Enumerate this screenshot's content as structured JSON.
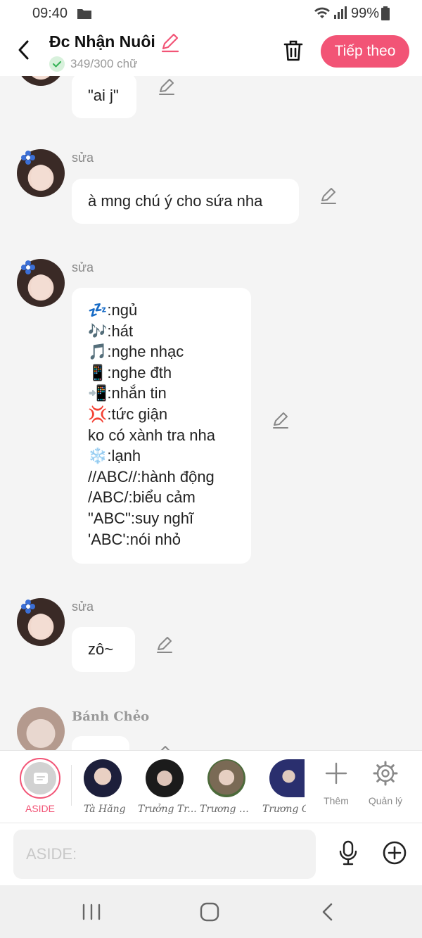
{
  "status_bar": {
    "time": "09:40",
    "battery": "99%"
  },
  "header": {
    "title": "Đc Nhận Nuôi",
    "word_count": "349/300 chữ",
    "next_label": "Tiếp theo"
  },
  "messages": [
    {
      "text": "\"ai j\""
    },
    {
      "sender": "sửa",
      "text": "à mng chú ý cho sứa nha"
    },
    {
      "sender": "sửa",
      "lines": [
        "💤:ngủ",
        "🎶:hát",
        "🎵:nghe nhạc",
        "📱:nghe đth",
        "📲:nhắn tin",
        "💢:tức giận",
        "ko có xành tra nha",
        "❄️:lạnh",
        "//ABC//:hành động",
        "/ABC/:biểu cảm",
        "\"ABC\":suy nghĩ",
        "'ABC':nói nhỏ"
      ]
    },
    {
      "sender": "sửa",
      "text": "zô~"
    },
    {
      "sender": "Bánh Chẻo"
    }
  ],
  "characters": {
    "aside_label": "ASIDE",
    "items": [
      {
        "name": "Tà Hăng"
      },
      {
        "name": "Trưởng Tr..."
      },
      {
        "name": "Trương T..."
      },
      {
        "name": "Trương C"
      }
    ],
    "more_label": "Thêm",
    "manage_label": "Quản lý"
  },
  "input": {
    "placeholder": "ASIDE:"
  },
  "colors": {
    "accent": "#f25476",
    "background": "#f4f4f4",
    "bubble": "#ffffff"
  },
  "icons": [
    "folder-icon",
    "wifi-icon",
    "signal-icon",
    "battery-icon",
    "back-icon",
    "pencil-icon",
    "check-icon",
    "trash-icon",
    "edit-pen-icon",
    "plus-icon",
    "gear-icon",
    "mic-icon",
    "add-circle-icon",
    "nav-recent-icon",
    "nav-home-icon",
    "nav-back-icon"
  ]
}
